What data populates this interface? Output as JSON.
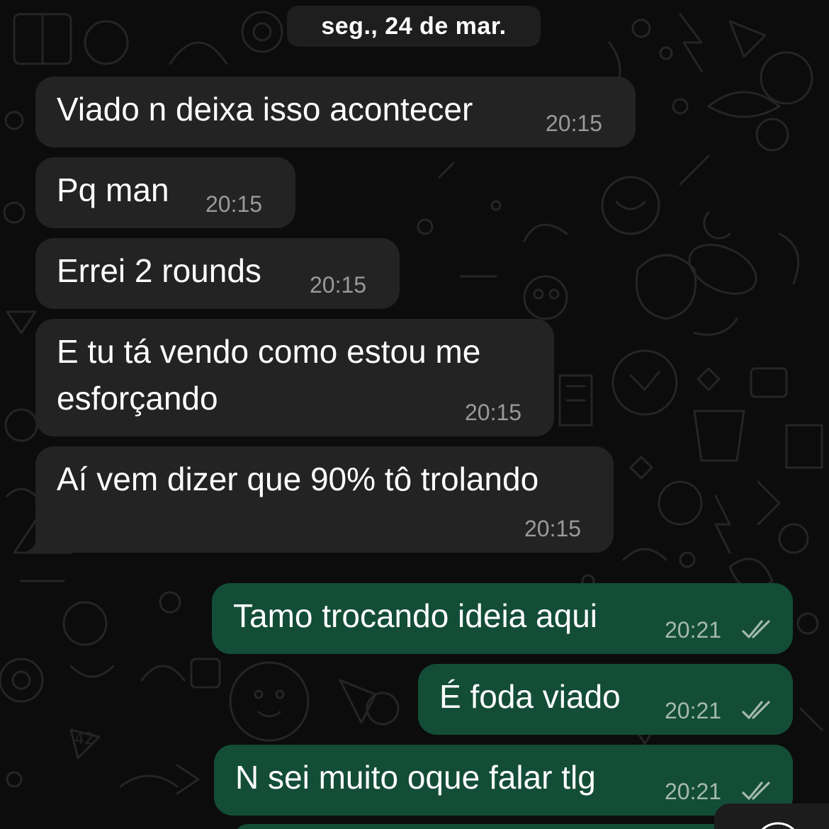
{
  "date_separator": "seg., 24 de mar.",
  "messages": [
    {
      "direction": "incoming",
      "text": "Viado n deixa isso acontecer",
      "time": "20:15"
    },
    {
      "direction": "incoming",
      "text": "Pq man",
      "time": "20:15"
    },
    {
      "direction": "incoming",
      "text": "Errei 2 rounds",
      "time": "20:15"
    },
    {
      "direction": "incoming",
      "text_line1": "E tu tá vendo como estou me",
      "text_line2": "esforçando",
      "time": "20:15"
    },
    {
      "direction": "incoming",
      "text": "Aí vem dizer que 90% tô trolando",
      "time": "20:15"
    },
    {
      "direction": "outgoing",
      "text": "Tamo trocando ideia aqui",
      "time": "20:21",
      "status": "read"
    },
    {
      "direction": "outgoing",
      "text": "É foda viado",
      "time": "20:21",
      "status": "read"
    },
    {
      "direction": "outgoing",
      "text": "N sei muito oque falar tlg",
      "time": "20:21",
      "status": "read"
    }
  ],
  "colors": {
    "background": "#0c0c0c",
    "incoming_bubble": "#232323",
    "outgoing_bubble": "#134d37",
    "timestamp": "#9a9a9a",
    "read_ticks": "#a4b9ad"
  },
  "icons": [
    "double-check-icon",
    "scroll-down-icon"
  ]
}
